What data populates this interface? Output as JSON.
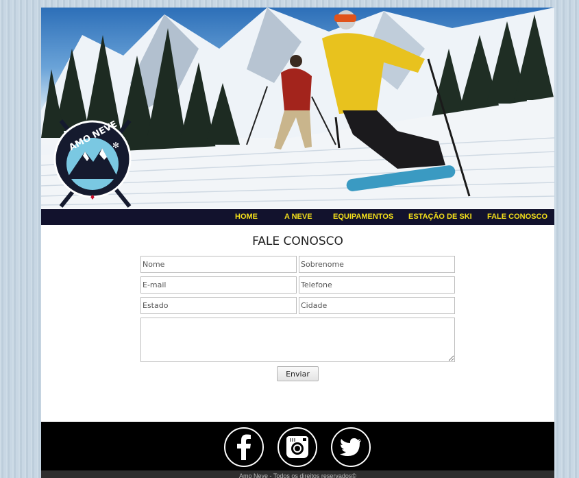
{
  "brand": {
    "logo_text": "AMO NEVE"
  },
  "nav": {
    "items": [
      {
        "label": "HOME"
      },
      {
        "label": "A NEVE"
      },
      {
        "label": "EQUIPAMENTOS"
      },
      {
        "label": "ESTAÇÃO DE SKI"
      },
      {
        "label": "FALE CONOSCO"
      }
    ]
  },
  "contact": {
    "title": "FALE CONOSCO",
    "fields": {
      "nome": "Nome",
      "sobrenome": "Sobrenome",
      "email": "E-mail",
      "telefone": "Telefone",
      "estado": "Estado",
      "cidade": "Cidade"
    },
    "message": "",
    "submit_label": "Enviar"
  },
  "footer": {
    "social": [
      "facebook-icon",
      "instagram-icon",
      "twitter-icon"
    ],
    "copyright": "Amo Neve - Todos os direitos reservados©"
  },
  "colors": {
    "nav_bg": "#12122d",
    "nav_text": "#f4e01a",
    "footer_bg": "#000000"
  }
}
